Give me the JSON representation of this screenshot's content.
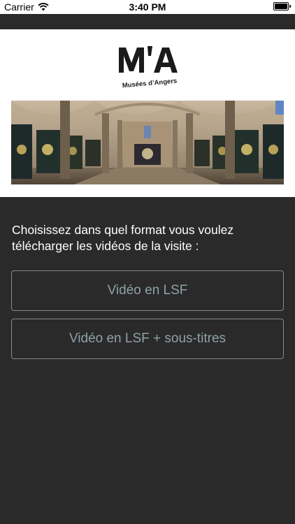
{
  "status_bar": {
    "carrier": "Carrier",
    "time": "3:40 PM",
    "icons": [
      "wifi-icon",
      "battery-icon"
    ]
  },
  "header": {
    "logo_text": "M'A",
    "logo_tagline": "Musées d'Angers",
    "hero_image": "museum-gallery-interior-with-tapestries"
  },
  "content": {
    "prompt": "Choisissez dans quel format vous voulez télécharger les vidéos de la visite :",
    "buttons": [
      {
        "label": "Vidéo en LSF"
      },
      {
        "label": "Vidéo en LSF + sous-titres"
      }
    ]
  },
  "colors": {
    "background": "#2a2a2a",
    "header_background": "#ffffff",
    "button_border": "#8a8a8a",
    "button_text": "#8fa1a6",
    "prompt_text": "#ffffff"
  }
}
